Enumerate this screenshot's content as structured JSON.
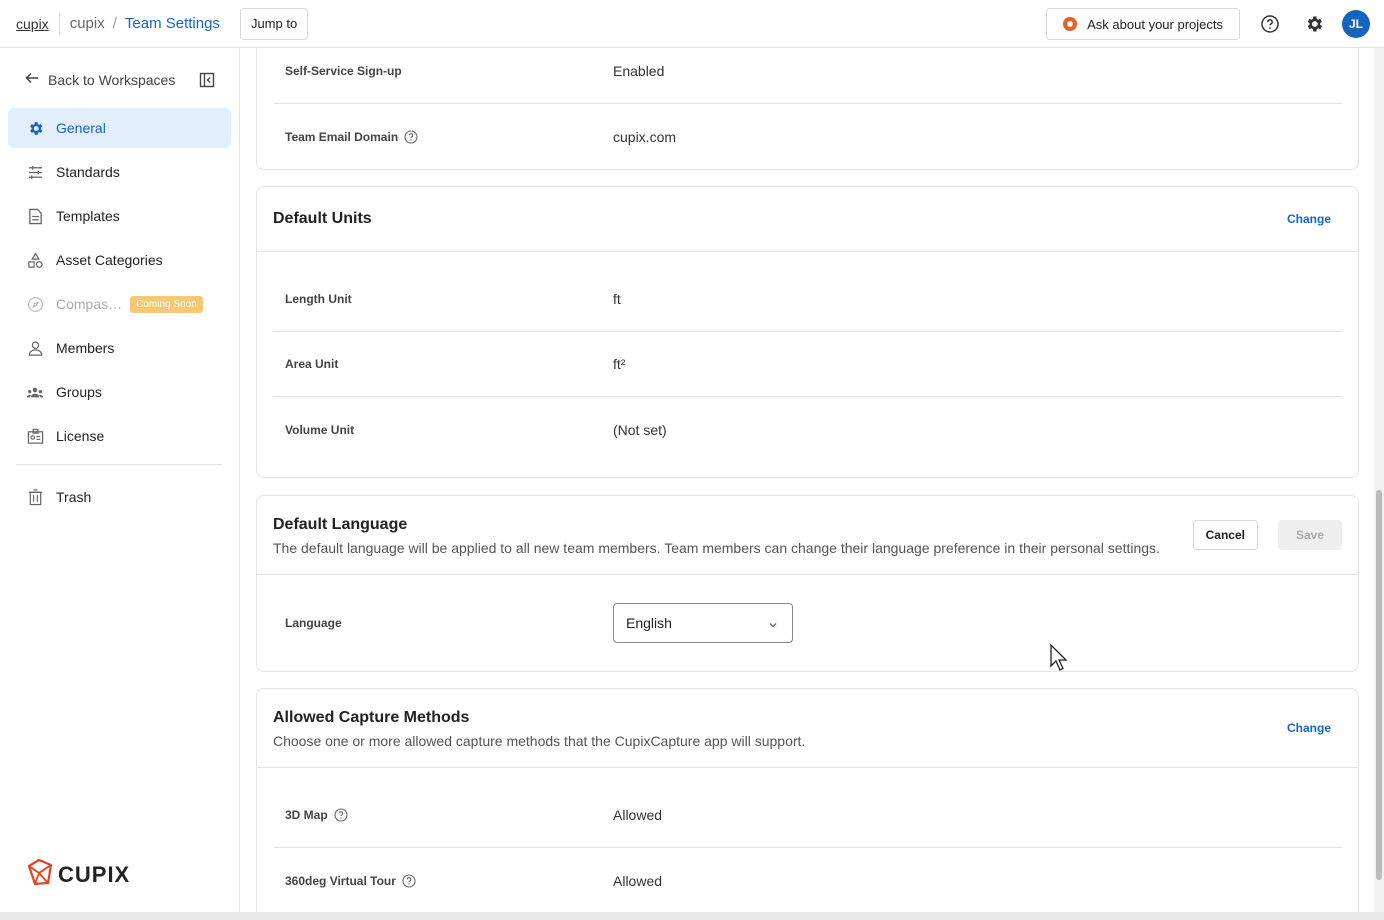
{
  "topbar": {
    "logo": "cupix",
    "breadcrumb_root": "cupix",
    "breadcrumb_sep": "/",
    "breadcrumb_current": "Team Settings",
    "jump_label": "Jump to",
    "ask_label": "Ask about your projects",
    "avatar_initials": "JL",
    "icons": [
      "help-icon",
      "gear-icon"
    ]
  },
  "sidebar": {
    "back_label": "Back to Workspaces",
    "items": [
      {
        "label": "General",
        "icon": "gear-icon",
        "active": true
      },
      {
        "label": "Standards",
        "icon": "sliders-icon"
      },
      {
        "label": "Templates",
        "icon": "document-icon"
      },
      {
        "label": "Asset Categories",
        "icon": "shapes-icon"
      },
      {
        "label": "Compas…",
        "icon": "compass-icon",
        "disabled": true,
        "badge": "Coming Soon"
      },
      {
        "label": "Members",
        "icon": "person-icon"
      },
      {
        "label": "Groups",
        "icon": "group-icon"
      },
      {
        "label": "License",
        "icon": "license-icon"
      }
    ],
    "trash_label": "Trash",
    "brand": "CUPIX"
  },
  "signup_card": {
    "rows": [
      {
        "label": "Self-Service Sign-up",
        "value": "Enabled"
      },
      {
        "label": "Team Email Domain",
        "value": "cupix.com"
      }
    ]
  },
  "units_card": {
    "title": "Default Units",
    "change": "Change",
    "rows": [
      {
        "label": "Length Unit",
        "value": "ft"
      },
      {
        "label": "Area Unit",
        "value": "ft²"
      },
      {
        "label": "Volume Unit",
        "value": "(Not set)"
      }
    ]
  },
  "language_card": {
    "title": "Default Language",
    "description": "The default language will be applied to all new team members. Team members can change their language preference in their personal settings.",
    "cancel": "Cancel",
    "save": "Save",
    "label": "Language",
    "selected": "English"
  },
  "capture_card": {
    "title": "Allowed Capture Methods",
    "description": "Choose one or more allowed capture methods that the CupixCapture app will support.",
    "change": "Change",
    "rows": [
      {
        "label": "3D Map",
        "value": "Allowed"
      },
      {
        "label": "360deg Virtual Tour",
        "value": "Allowed"
      }
    ]
  },
  "colors": {
    "accent": "#1565c0",
    "active_bg": "#e3eefc",
    "badge": "#f7c873"
  }
}
